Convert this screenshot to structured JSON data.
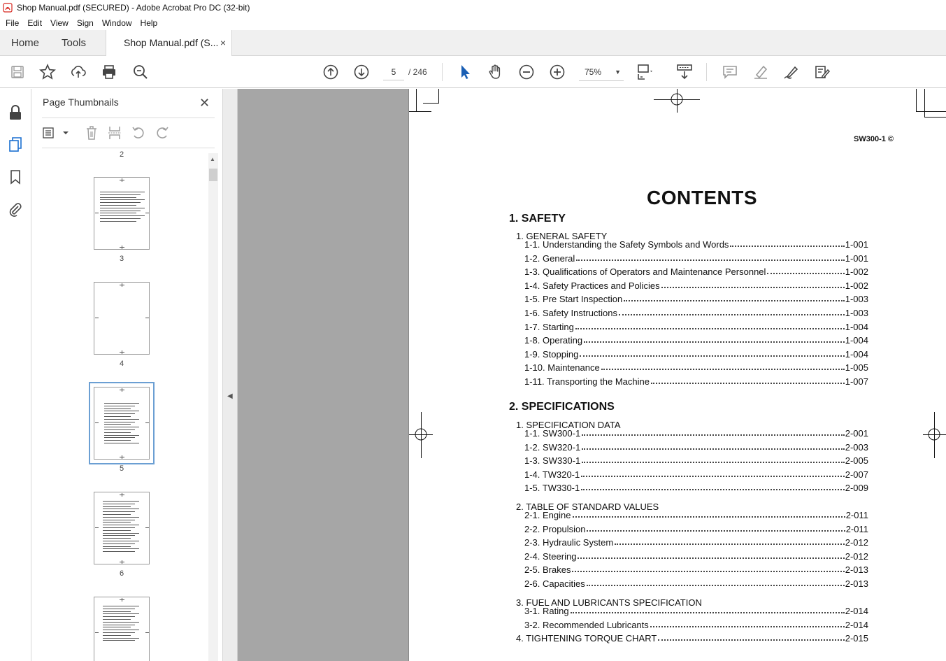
{
  "window": {
    "title": "Shop Manual.pdf (SECURED) - Adobe Acrobat Pro DC (32-bit)"
  },
  "menu": [
    "File",
    "Edit",
    "View",
    "Sign",
    "Window",
    "Help"
  ],
  "tabs": {
    "home": "Home",
    "tools": "Tools",
    "document": "Shop Manual.pdf (S...",
    "close": "×"
  },
  "toolbar": {
    "current_page": "5",
    "total_pages": "/ 246",
    "zoom": "75%",
    "icons": [
      "save-icon",
      "bookmark-star-icon",
      "upload-icon",
      "print-icon",
      "zoom-search-icon",
      "prev-page-icon",
      "next-page-icon",
      "select-cursor-icon",
      "hand-icon",
      "zoom-out-icon",
      "zoom-in-icon",
      "fit-page-icon",
      "scroll-mode-icon",
      "comment-icon",
      "highlight-icon",
      "sign-icon",
      "edit-pdf-icon"
    ]
  },
  "thumbnails_panel": {
    "title": "Page Thumbnails",
    "close": "✕",
    "pages": [
      "2",
      "3",
      "4",
      "5",
      "6"
    ],
    "selected_page": "5"
  },
  "document": {
    "code": "SW300-1",
    "title": "CONTENTS",
    "sections": [
      {
        "heading": "1. SAFETY",
        "subsections": [
          {
            "heading": "1. GENERAL SAFETY",
            "items": [
              {
                "label": "1-1. Understanding the Safety Symbols and Words",
                "page": "1-001"
              },
              {
                "label": "1-2. General",
                "page": "1-001"
              },
              {
                "label": "1-3. Qualifications of Operators and Maintenance Personnel",
                "page": "1-002"
              },
              {
                "label": "1-4. Safety Practices and Policies",
                "page": "1-002"
              },
              {
                "label": "1-5. Pre Start Inspection",
                "page": "1-003"
              },
              {
                "label": "1-6. Safety Instructions",
                "page": "1-003"
              },
              {
                "label": "1-7. Starting",
                "page": "1-004"
              },
              {
                "label": "1-8. Operating",
                "page": "1-004"
              },
              {
                "label": "1-9. Stopping",
                "page": "1-004"
              },
              {
                "label": "1-10. Maintenance",
                "page": "1-005"
              },
              {
                "label": "1-11. Transporting the Machine",
                "page": "1-007"
              }
            ]
          }
        ]
      },
      {
        "heading": "2. SPECIFICATIONS",
        "subsections": [
          {
            "heading": "1. SPECIFICATION DATA",
            "items": [
              {
                "label": "1-1. SW300-1",
                "page": "2-001"
              },
              {
                "label": "1-2. SW320-1",
                "page": "2-003"
              },
              {
                "label": "1-3. SW330-1",
                "page": "2-005"
              },
              {
                "label": "1-4. TW320-1",
                "page": "2-007"
              },
              {
                "label": "1-5. TW330-1",
                "page": "2-009"
              }
            ]
          },
          {
            "heading": "2. TABLE OF STANDARD VALUES",
            "items": [
              {
                "label": "2-1. Engine",
                "page": "2-011"
              },
              {
                "label": "2-2. Propulsion",
                "page": "2-011"
              },
              {
                "label": "2-3. Hydraulic System",
                "page": "2-012"
              },
              {
                "label": "2-4. Steering",
                "page": "2-012"
              },
              {
                "label": "2-5. Brakes",
                "page": "2-013"
              },
              {
                "label": "2-6. Capacities",
                "page": "2-013"
              }
            ]
          },
          {
            "heading": "3. FUEL AND LUBRICANTS SPECIFICATION",
            "items": [
              {
                "label": "3-1. Rating",
                "page": "2-014"
              },
              {
                "label": "3-2. Recommended Lubricants",
                "page": "2-014"
              }
            ]
          }
        ],
        "final_item": {
          "label": "4. TIGHTENING TORQUE CHART",
          "page": "2-015"
        }
      }
    ]
  },
  "colors": {
    "gutter": "#a6a6a6",
    "selection": "#6b9fd3",
    "acrobat_red": "#d7261e"
  }
}
